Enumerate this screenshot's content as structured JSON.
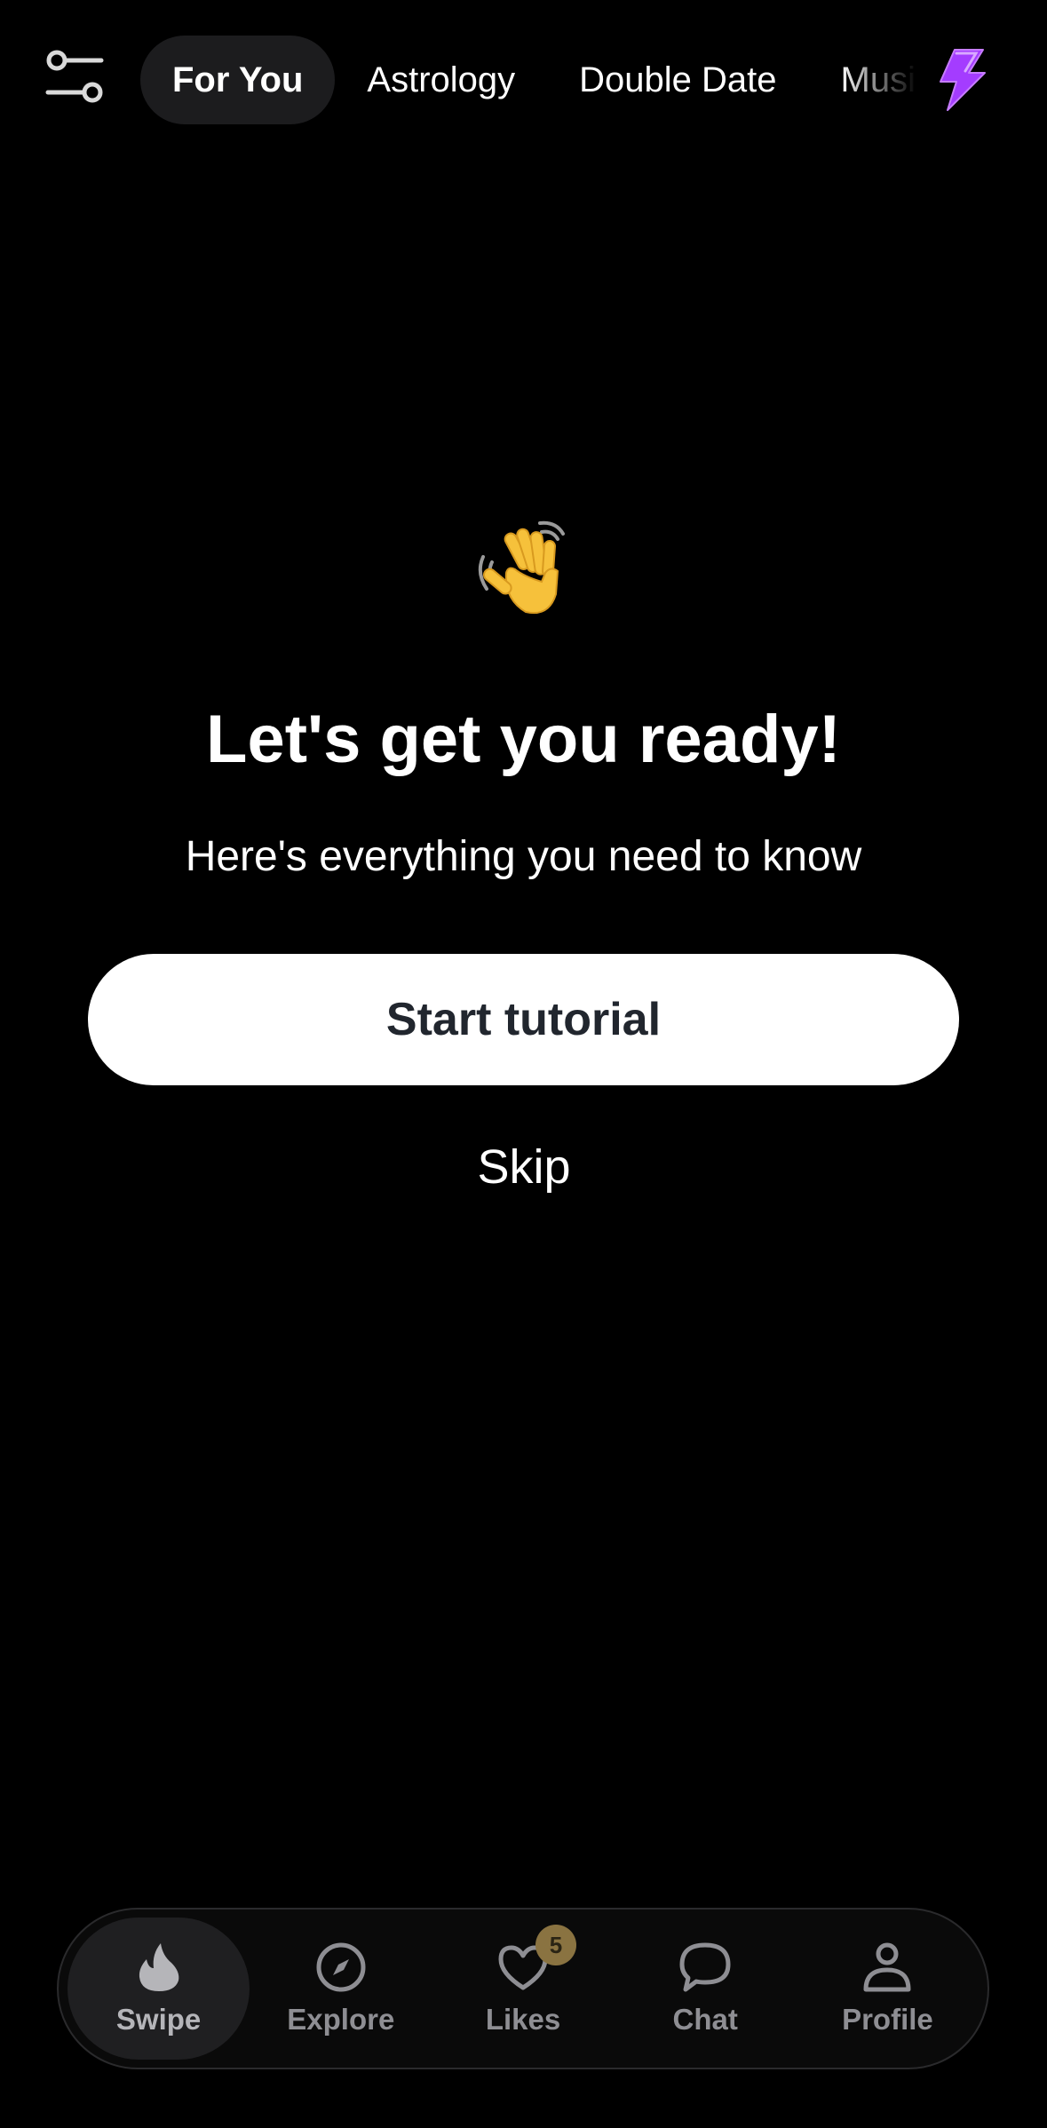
{
  "header": {
    "tabs": [
      {
        "label": "For You",
        "active": true
      },
      {
        "label": "Astrology",
        "active": false
      },
      {
        "label": "Double Date",
        "active": false
      },
      {
        "label": "Music",
        "active": false
      }
    ],
    "filter_icon": "sliders-icon",
    "boost_icon": "lightning-bolt-icon",
    "boost_color": "#a43cff"
  },
  "main": {
    "emoji": "👋",
    "title": "Let's get you ready!",
    "subtitle": "Here's everything you need to know",
    "start_label": "Start tutorial",
    "skip_label": "Skip"
  },
  "nav": {
    "items": [
      {
        "label": "Swipe",
        "icon": "flame-icon",
        "active": true
      },
      {
        "label": "Explore",
        "icon": "compass-icon",
        "active": false
      },
      {
        "label": "Likes",
        "icon": "heart-icon",
        "active": false,
        "badge": "5"
      },
      {
        "label": "Chat",
        "icon": "chat-bubble-icon",
        "active": false
      },
      {
        "label": "Profile",
        "icon": "person-icon",
        "active": false
      }
    ]
  },
  "colors": {
    "background": "#000000",
    "button_bg": "#ffffff",
    "button_text": "#21262e",
    "badge_bg": "#8a7341",
    "nav_inactive": "#8e8e93"
  }
}
